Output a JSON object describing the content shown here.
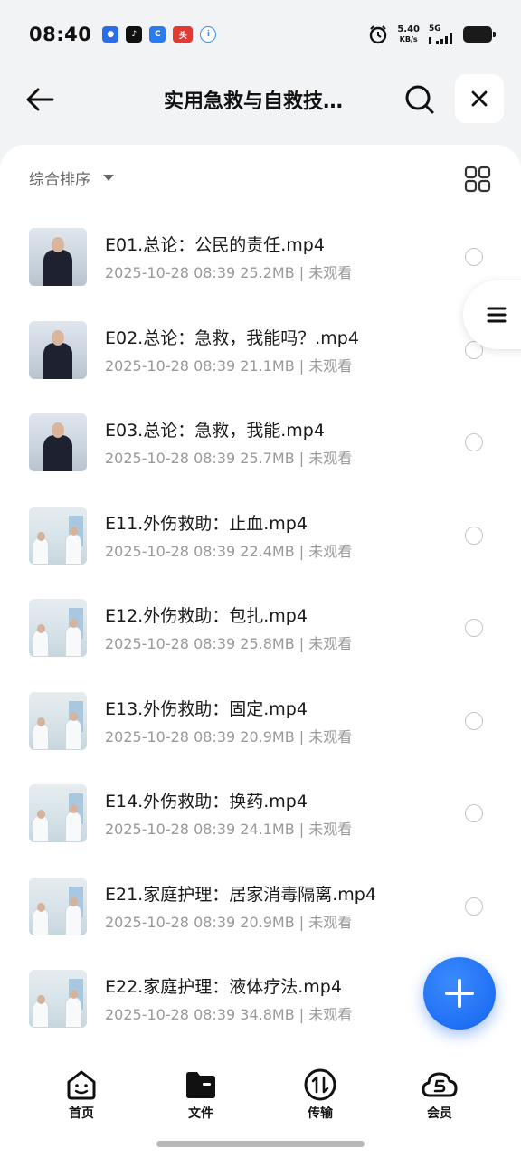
{
  "status_bar": {
    "time": "08:40",
    "net_speed_value": "5.40",
    "net_speed_unit": "KB/s",
    "signal": "5G",
    "apps": [
      {
        "icon": "baidu-netdisk-icon",
        "color": "#2b6de8"
      },
      {
        "icon": "tiktok-icon",
        "color": "#111111"
      },
      {
        "icon": "browser-icon",
        "color": "#2a7bf0"
      },
      {
        "icon": "toutiao-icon",
        "color": "#e03a32"
      },
      {
        "icon": "ifly-icon",
        "color": "#3a8ee8"
      }
    ]
  },
  "header": {
    "title": "实用急救与自救技…",
    "back_icon": "arrow-left-icon",
    "search_icon": "search-icon",
    "close_icon": "close-icon"
  },
  "sort": {
    "label": "综合排序",
    "view_icon": "grid-view-icon"
  },
  "files": [
    {
      "name": "E01.总论：公民的责任.mp4",
      "meta": "2025-10-28 08:39  25.2MB | 未观看",
      "thumb": "lecturer"
    },
    {
      "name": "E02.总论：急救，我能吗？.mp4",
      "meta": "2025-10-28 08:39  21.1MB | 未观看",
      "thumb": "lecturer"
    },
    {
      "name": "E03.总论：急救，我能.mp4",
      "meta": "2025-10-28 08:39  25.7MB | 未观看",
      "thumb": "lecturer"
    },
    {
      "name": "E11.外伤救助：止血.mp4",
      "meta": "2025-10-28 08:39  22.4MB | 未观看",
      "thumb": "doctors"
    },
    {
      "name": "E12.外伤救助：包扎.mp4",
      "meta": "2025-10-28 08:39  25.8MB | 未观看",
      "thumb": "doctors"
    },
    {
      "name": "E13.外伤救助：固定.mp4",
      "meta": "2025-10-28 08:39  20.9MB | 未观看",
      "thumb": "doctors"
    },
    {
      "name": "E14.外伤救助：换药.mp4",
      "meta": "2025-10-28 08:39  24.1MB | 未观看",
      "thumb": "doctors"
    },
    {
      "name": "E21.家庭护理：居家消毒隔离.mp4",
      "meta": "2025-10-28 08:39  20.9MB | 未观看",
      "thumb": "doctors"
    },
    {
      "name": "E22.家庭护理：液体疗法.mp4",
      "meta": "2025-10-28 08:39  34.8MB | 未观看",
      "thumb": "doctors"
    }
  ],
  "side_tab_icon": "menu-icon",
  "fab_icon": "plus-icon",
  "bottom_nav": [
    {
      "label": "首页",
      "icon": "home-face-icon"
    },
    {
      "label": "文件",
      "icon": "folder-icon"
    },
    {
      "label": "传输",
      "icon": "transfer-icon"
    },
    {
      "label": "会员",
      "icon": "vip-cloud-icon"
    }
  ],
  "colors": {
    "accent": "#1464f0",
    "background": "#f2f3f5",
    "meta_text": "#999999"
  }
}
